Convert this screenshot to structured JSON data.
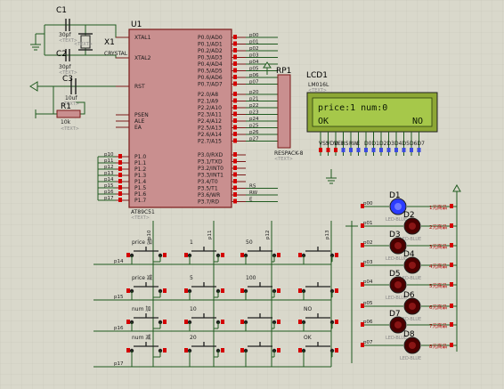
{
  "components": {
    "c1": {
      "ref": "C1",
      "value": "30pf"
    },
    "c2": {
      "ref": "C2",
      "value": "30pf"
    },
    "c3": {
      "ref": "C3",
      "value": "10uf"
    },
    "x1": {
      "ref": "X1",
      "value": "CRYSTAL"
    },
    "r1": {
      "ref": "R1",
      "value": "10k"
    },
    "u1": {
      "ref": "U1",
      "part": "AT89C51"
    },
    "rp1": {
      "ref": "RP1",
      "part": "RESPACK-8"
    },
    "lcd1": {
      "ref": "LCD1",
      "part": "LM016L",
      "line1": "price:1  num:0",
      "line2_left": "OK",
      "line2_right": "NO"
    }
  },
  "placeholder": "<TEXT>",
  "u1_left_pins": [
    "XTAL1",
    "XTAL2",
    "RST",
    "PSEN",
    "ALE",
    "EA",
    "P1.0",
    "P1.1",
    "P1.2",
    "P1.3",
    "P1.4",
    "P1.5",
    "P1.6",
    "P1.7"
  ],
  "u1_right_pins_p0": [
    "P0.0/AD0",
    "P0.1/AD1",
    "P0.2/AD2",
    "P0.3/AD3",
    "P0.4/AD4",
    "P0.5/AD5",
    "P0.6/AD6",
    "P0.7/AD7"
  ],
  "u1_right_pins_p2": [
    "P2.0/A8",
    "P2.1/A9",
    "P2.2/A10",
    "P2.3/A11",
    "P2.4/A12",
    "P2.5/A13",
    "P2.6/A14",
    "P2.7/A15"
  ],
  "u1_right_pins_p3": [
    "P3.0/RXD",
    "P3.1/TXD",
    "P3.2/INT0",
    "P3.3/INT1",
    "P3.4/T0",
    "P3.5/T1",
    "P3.6/WR",
    "P3.7/RD"
  ],
  "p0_nets": [
    "p00",
    "p01",
    "p02",
    "p03",
    "p04",
    "p05",
    "p06",
    "p07"
  ],
  "p2_nets": [
    "p20",
    "p21",
    "p22",
    "p23",
    "p24",
    "p25",
    "p26",
    "p27"
  ],
  "p1_nets": [
    "p10",
    "p11",
    "p12",
    "p13",
    "p14",
    "p15",
    "p16",
    "p17"
  ],
  "p3_nets": [
    "RS",
    "RW",
    "E"
  ],
  "key_labels": [
    [
      "price 加",
      "1",
      "50",
      ""
    ],
    [
      "price 减",
      "5",
      "100",
      ""
    ],
    [
      "num 加",
      "10",
      "",
      "NO"
    ],
    [
      "num 减",
      "20",
      "",
      "OK"
    ]
  ],
  "row_nets": [
    "p14",
    "p15",
    "p16",
    "p17"
  ],
  "col_nets": [
    "p10",
    "p11",
    "p12",
    "p13"
  ],
  "leds": {
    "refs": [
      "D1",
      "D2",
      "D3",
      "D4",
      "D5",
      "D6",
      "D7",
      "D8"
    ],
    "part": "LED-BLUE",
    "nets": [
      "p00",
      "p01",
      "p02",
      "p03",
      "p04",
      "p05",
      "p06",
      "p07"
    ],
    "labels": [
      "1元商品",
      "2元商品",
      "3元商品",
      "4元商品",
      "5元商品",
      "6元商品",
      "7元商品",
      "8元商品"
    ]
  },
  "colors": {
    "background": "#d9d8cb",
    "wire": "#1f5a1f",
    "body": "#c98f8f",
    "outline": "#7a1a1a",
    "lcd": "#9cc43c",
    "led_on": "#2b3cff",
    "led_off": "#4a0000"
  }
}
